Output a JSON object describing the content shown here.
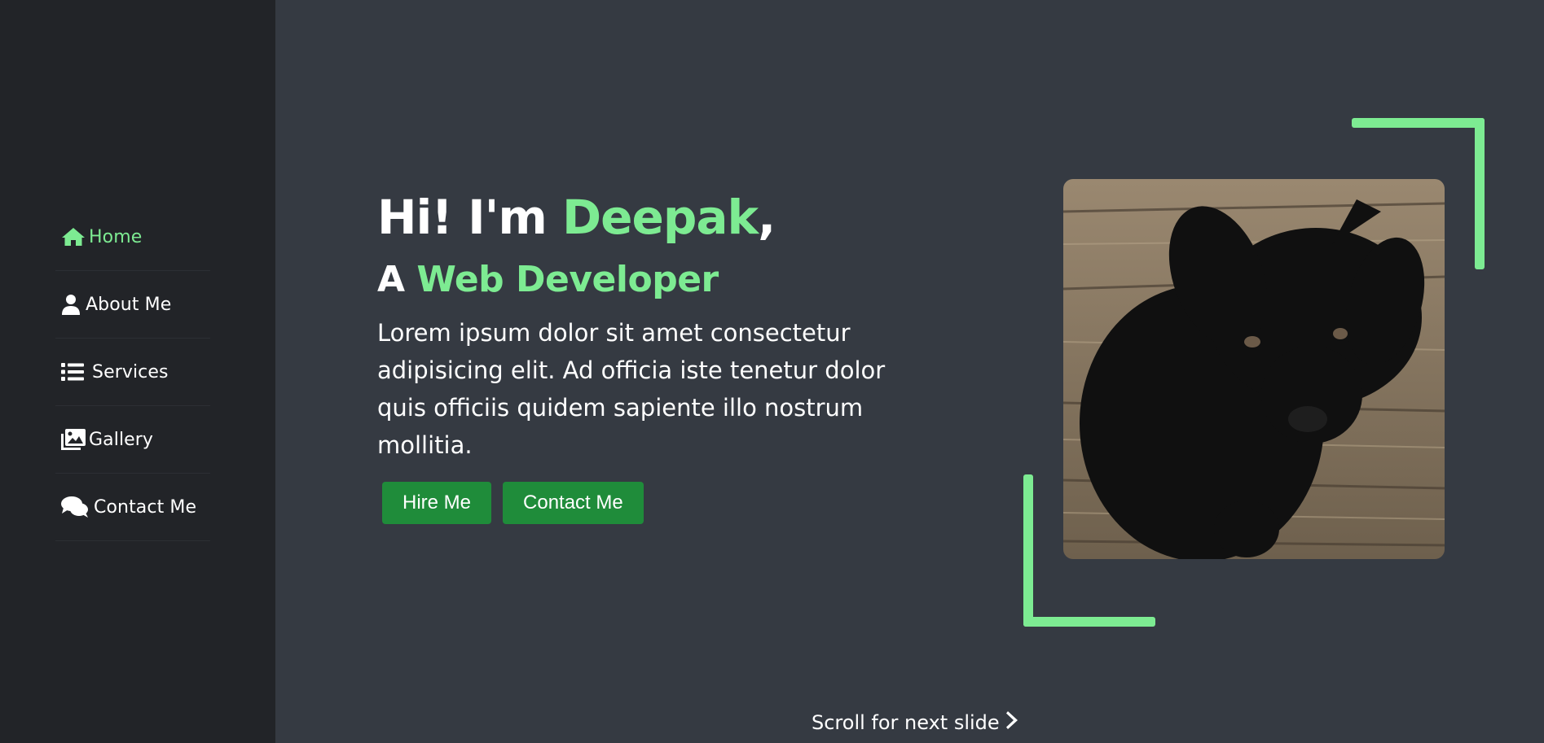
{
  "sidebar": {
    "items": [
      {
        "label": "Home",
        "icon": "home-icon",
        "active": true
      },
      {
        "label": "About Me",
        "icon": "user-icon",
        "active": false
      },
      {
        "label": "Services",
        "icon": "list-icon",
        "active": false
      },
      {
        "label": "Gallery",
        "icon": "images-icon",
        "active": false
      },
      {
        "label": "Contact Me",
        "icon": "comments-icon",
        "active": false
      }
    ]
  },
  "hero": {
    "greeting_prefix": "Hi! I'm ",
    "name": "Deepak",
    "greeting_suffix": ",",
    "role_prefix": "A ",
    "role": "Web Developer",
    "description": "Lorem ipsum dolor sit amet consectetur adipisicing elit. Ad officia iste tenetur dolor quis officiis quidem sapiente illo nostrum mollitia.",
    "hire_button": "Hire Me",
    "contact_button": "Contact Me"
  },
  "scroll_hint": {
    "label": "Scroll for next slide",
    "icon": "chevron-right-icon"
  },
  "colors": {
    "accent": "#7deb92",
    "button": "#1f8c3a",
    "background": "#353a42",
    "sidebar": "#222428"
  }
}
